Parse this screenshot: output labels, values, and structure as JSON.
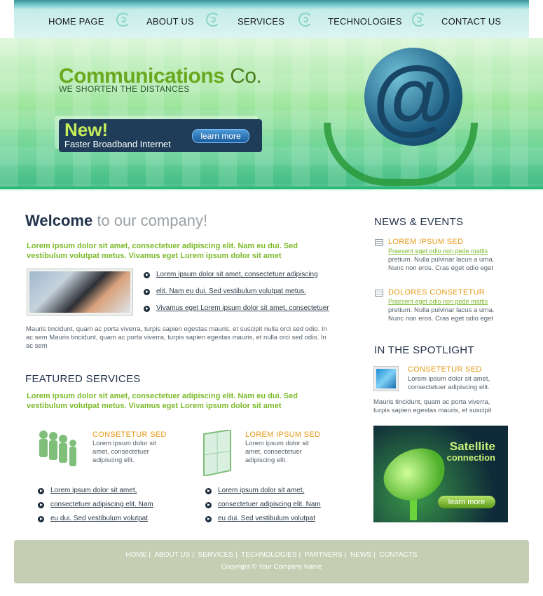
{
  "nav": {
    "items": [
      "HOME PAGE",
      "ABOUT US",
      "SERVICES",
      "TECHNOLOGIES",
      "CONTACT US"
    ]
  },
  "banner": {
    "brand_main": "Communications",
    "brand_co": "Co.",
    "slogan": "WE SHORTEN THE DISTANCES",
    "promo_new": "New!",
    "promo_text": "Faster Broadband Internet",
    "promo_button": "learn more"
  },
  "welcome": {
    "title_bold": "Welcome",
    "title_rest": "to our company!",
    "intro": "Lorem ipsum dolor sit amet, consectetuer adipiscing elit. Nam eu dui. Sed vestibulum volutpat metus. Vivamus eget Lorem ipsum dolor sit amet",
    "links": [
      "Lorem ipsum dolor sit amet, consectetuer adipiscing",
      "elit. Nam eu dui. Sed vestibulum volutpat metus.",
      "Vivamus eget Lorem ipsum dolor sit amet, consectetuer"
    ],
    "body": "Mauris tincidunt, quam ac porta viverra, turpis sapien egestas mauris, et suscipit nulla orci sed odio. In ac sem Mauris tincidunt, quam ac porta viverra, turpis sapien egestas mauris, et nulla orci sed odio. In ac sem"
  },
  "featured": {
    "title": "FEATURED SERVICES",
    "intro": "Lorem ipsum dolor sit amet, consectetuer adipiscing elit. Nam eu dui. Sed vestibulum volutpat metus. Vivamus eget Lorem ipsum dolor sit amet",
    "services": [
      {
        "title": "CONSETETUR SED",
        "text": "Lorem ipsum dolor sit amet, consectetuer adipiscing elit."
      },
      {
        "title": "LOREM IPSUM SED",
        "text": "Lorem ipsum dolor sit amet, consectetuer adipiscing elit."
      }
    ],
    "links_left": [
      "Lorem ipsum dolor sit amet,",
      "consectetuer adipiscing elit. Nam",
      "eu dui. Sed vestibulum volutpat"
    ],
    "links_right": [
      "Lorem ipsum dolor sit amet,",
      "consectetuer adipiscing elit. Nam",
      "eu dui. Sed vestibulum volutpat"
    ]
  },
  "news": {
    "title": "NEWS & EVENTS",
    "items": [
      {
        "title": "LOREM IPSUM SED",
        "link": "Praesent eget odio non pede mattis",
        "text": "pretium. Nulla pulvinar lacus a urna. Nunc non eros. Cras eget odio eget"
      },
      {
        "title": "DOLORES CONSETETUR",
        "link": "Praesent eget odio non pede mattis",
        "text": "pretium. Nulla pulvinar lacus a urna. Nunc non eros. Cras eget odio eget"
      }
    ]
  },
  "spotlight": {
    "title": "IN THE SPOTLIGHT",
    "item_title": "CONSETETUR SED",
    "item_text": "Lorem ipsum dolor sit amet, consectetuer adipiscing elit.",
    "body": "Mauris tincidunt, quam ac porta viverra, turpis sapien egestas mauris, et suscipit"
  },
  "satellite": {
    "title1": "Satellite",
    "title2": "connection",
    "button": "learn more"
  },
  "footer": {
    "links": [
      "HOME",
      "ABOUT US",
      "SERVICES",
      "TECHNOLOGIES",
      "PARTNERS",
      "NEWS",
      "CONTACTS"
    ],
    "copyright": "Copyright © Your Company Name"
  }
}
